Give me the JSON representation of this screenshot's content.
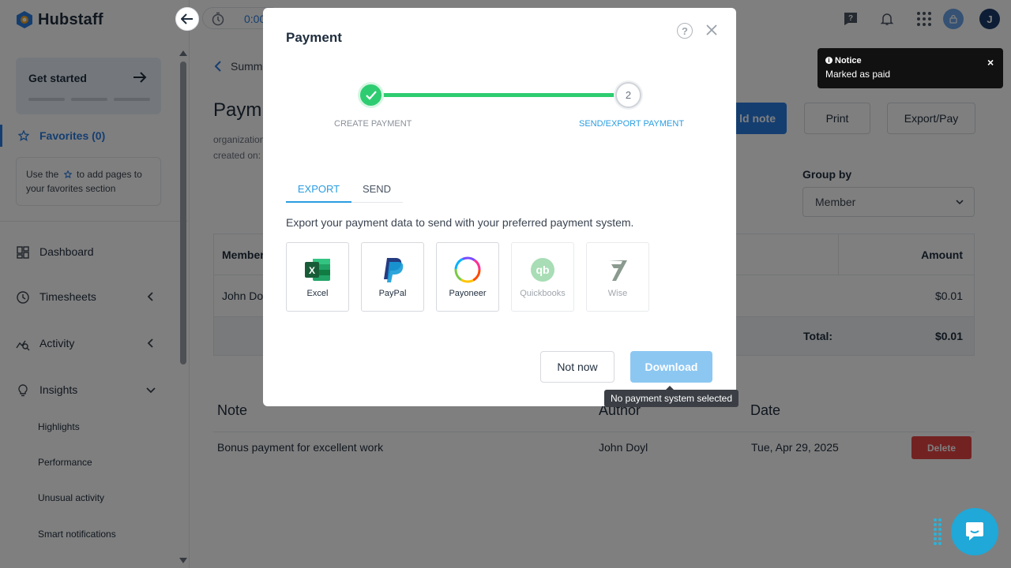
{
  "app": {
    "name": "Hubstaff",
    "timer": "0:00"
  },
  "sidebar": {
    "get_started": "Get started",
    "favorites": {
      "label": "Favorites (0)",
      "hint_before": "Use the",
      "hint_after": "to add pages to your favorites section"
    },
    "items": [
      {
        "label": "Dashboard"
      },
      {
        "label": "Timesheets"
      },
      {
        "label": "Activity"
      },
      {
        "label": "Insights"
      }
    ],
    "sub_items": [
      {
        "label": "Highlights"
      },
      {
        "label": "Performance"
      },
      {
        "label": "Unusual activity"
      },
      {
        "label": "Smart notifications"
      }
    ]
  },
  "page": {
    "breadcrumb": "Summ",
    "title": "Paym",
    "meta_org": "organization",
    "meta_created": "created on:",
    "buttons": {
      "add_note": "ld note",
      "print": "Print",
      "export_pay": "Export/Pay"
    },
    "group_by": {
      "label": "Group by",
      "value": "Member"
    },
    "table": {
      "headers": {
        "member": "Member",
        "amount": "Amount"
      },
      "rows": [
        {
          "member": "John Do",
          "amount": "$0.01"
        }
      ],
      "total_label": "Total:",
      "total_value": "$0.01"
    },
    "notes": {
      "headers": {
        "note": "Note",
        "author": "Author",
        "date": "Date"
      },
      "rows": [
        {
          "note": "Bonus payment for excellent work",
          "author": "John Doyl",
          "date": "Tue, Apr 29, 2025",
          "action": "Delete"
        }
      ]
    }
  },
  "modal": {
    "title": "Payment",
    "help": "?",
    "steps": [
      {
        "label": "CREATE PAYMENT",
        "status": "done"
      },
      {
        "label": "SEND/EXPORT PAYMENT",
        "number": "2",
        "status": "active"
      }
    ],
    "tabs": [
      {
        "label": "EXPORT",
        "active": true
      },
      {
        "label": "SEND",
        "active": false
      }
    ],
    "description": "Export your payment data to send with your preferred payment system.",
    "systems": [
      {
        "name": "Excel",
        "icon": "excel-icon",
        "enabled": true
      },
      {
        "name": "PayPal",
        "icon": "paypal-icon",
        "enabled": true
      },
      {
        "name": "Payoneer",
        "icon": "payoneer-icon",
        "enabled": true
      },
      {
        "name": "Quickbooks",
        "icon": "quickbooks-icon",
        "enabled": false
      },
      {
        "name": "Wise",
        "icon": "wise-icon",
        "enabled": false
      }
    ],
    "buttons": {
      "not_now": "Not now",
      "download": "Download"
    },
    "tooltip": "No payment system selected"
  },
  "toast": {
    "title": "Notice",
    "message": "Marked as paid",
    "close": "×"
  },
  "colors": {
    "accent": "#2a7de1",
    "success": "#2ecc71",
    "danger": "#e64545",
    "download_disabled": "#8cc7f2",
    "chat": "#1fa8d8"
  }
}
